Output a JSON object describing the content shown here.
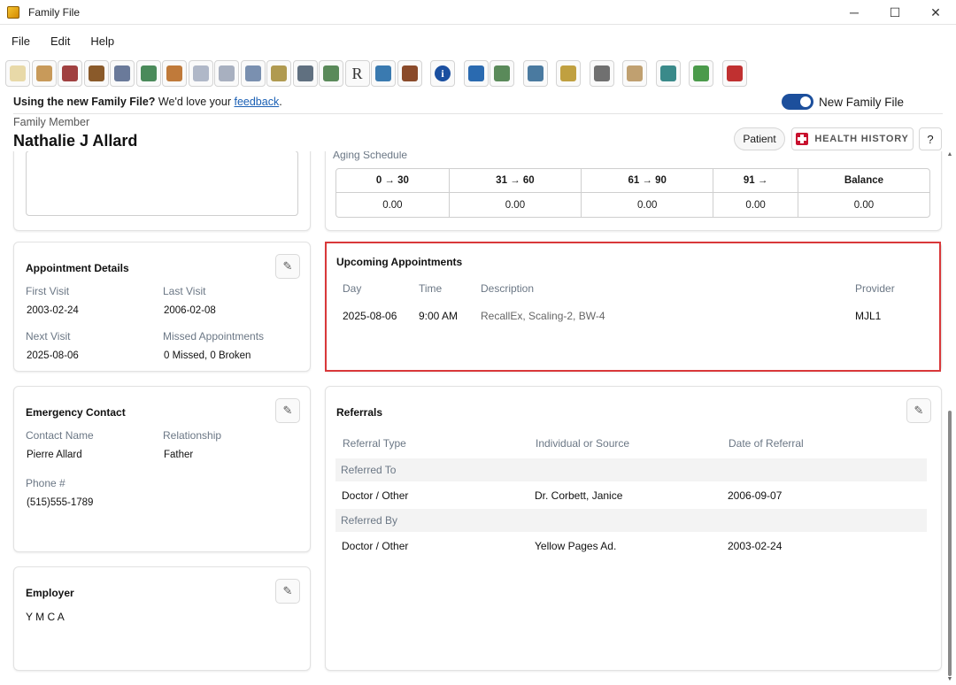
{
  "window": {
    "title": "Family File",
    "controls": [
      "─",
      "☐",
      "✕"
    ]
  },
  "menu": [
    "File",
    "Edit",
    "Help"
  ],
  "toolbar": {
    "icons": [
      {
        "name": "tooth-icon",
        "color": "#e8d9a8"
      },
      {
        "name": "chart-icon",
        "color": "#c89a5a"
      },
      {
        "name": "books-icon",
        "color": "#a04040"
      },
      {
        "name": "chair-icon",
        "color": "#8a5a2a"
      },
      {
        "name": "id-card-icon",
        "color": "#6a7a9a"
      },
      {
        "name": "globe-icon",
        "color": "#4a8a5a"
      },
      {
        "name": "bandage-icon",
        "color": "#c07a3a"
      },
      {
        "name": "card-icon",
        "color": "#b0b8c8"
      },
      {
        "name": "form-icon",
        "color": "#a8b0c0"
      },
      {
        "name": "schedule-icon",
        "color": "#7a90b0"
      },
      {
        "name": "money-icon",
        "color": "#b09a50"
      },
      {
        "name": "list-icon",
        "color": "#607080"
      },
      {
        "name": "document-icon",
        "color": "#5a8a5a"
      },
      {
        "name": "rx-icon",
        "color": "#333333",
        "glyph": "R"
      },
      {
        "name": "pencil-book-icon",
        "color": "#3a7ab0"
      },
      {
        "name": "folder-icon",
        "color": "#8a4a2a"
      },
      {
        "name": "info-icon",
        "color": "#1a4fa0"
      },
      {
        "name": "provider-icon",
        "color": "#2a6ab0"
      },
      {
        "name": "family-icon",
        "color": "#5a8a5a"
      },
      {
        "name": "link-icon",
        "color": "#4a7aa0"
      },
      {
        "name": "refresh-icon",
        "color": "#c0a040"
      },
      {
        "name": "printer-icon",
        "color": "#707070"
      },
      {
        "name": "page-icon",
        "color": "#c0a070"
      },
      {
        "name": "certificate-icon",
        "color": "#3a8a8a"
      },
      {
        "name": "recycle-icon",
        "color": "#4a9a4a"
      },
      {
        "name": "reader-icon",
        "color": "#c03030"
      }
    ]
  },
  "feedback": {
    "bold": "Using the new Family File?",
    "text": " We'd love your ",
    "link": "feedback",
    "end": "."
  },
  "toggle_label": "New Family File",
  "family_member": {
    "label": "Family Member",
    "name": "Nathalie J Allard"
  },
  "header_buttons": {
    "patient": "Patient",
    "health": "HEALTH HISTORY",
    "help": "?"
  },
  "aging": {
    "label": "Aging Schedule",
    "headers": [
      "0 → 30",
      "31 → 60",
      "61 → 90",
      "91 →",
      "Balance"
    ],
    "values": [
      "0.00",
      "0.00",
      "0.00",
      "0.00",
      "0.00"
    ]
  },
  "appointment_details": {
    "title": "Appointment Details",
    "first_visit_label": "First Visit",
    "first_visit": "2003-02-24",
    "last_visit_label": "Last Visit",
    "last_visit": "2006-02-08",
    "next_visit_label": "Next Visit",
    "next_visit": "2025-08-06",
    "missed_label": "Missed Appointments",
    "missed": "0 Missed, 0 Broken"
  },
  "upcoming": {
    "title": "Upcoming Appointments",
    "columns": [
      "Day",
      "Time",
      "Description",
      "Provider"
    ],
    "rows": [
      {
        "day": "2025-08-06",
        "time": "9:00 AM",
        "description": "RecallEx, Scaling-2, BW-4",
        "provider": "MJL1"
      }
    ]
  },
  "emergency": {
    "title": "Emergency Contact",
    "contact_label": "Contact Name",
    "contact": "Pierre Allard",
    "relationship_label": "Relationship",
    "relationship": "Father",
    "phone_label": "Phone #",
    "phone": "(515)555-1789"
  },
  "employer": {
    "title": "Employer",
    "value": "Y M C A"
  },
  "referrals": {
    "title": "Referrals",
    "columns": [
      "Referral Type",
      "Individual or Source",
      "Date of Referral"
    ],
    "to_label": "Referred To",
    "to": {
      "type": "Doctor / Other",
      "source": "Dr. Corbett, Janice",
      "date": "2006-09-07"
    },
    "by_label": "Referred By",
    "by": {
      "type": "Doctor / Other",
      "source": "Yellow Pages Ad.",
      "date": "2003-02-24"
    }
  }
}
